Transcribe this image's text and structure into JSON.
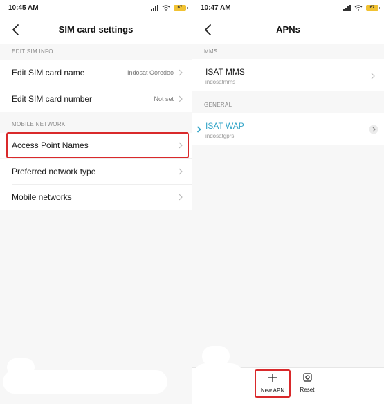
{
  "left": {
    "status": {
      "time": "10:45 AM",
      "battery": "67"
    },
    "title": "SIM card settings",
    "sections": [
      {
        "header": "EDIT SIM INFO"
      },
      {
        "header": "MOBILE NETWORK"
      }
    ],
    "rows": [
      {
        "label": "Edit SIM card name",
        "value": "Indosat Ooredoo"
      },
      {
        "label": "Edit SIM card number",
        "value": "Not set"
      },
      {
        "label": "Access Point Names",
        "value": ""
      },
      {
        "label": "Preferred network type",
        "value": ""
      },
      {
        "label": "Mobile networks",
        "value": ""
      }
    ]
  },
  "right": {
    "status": {
      "time": "10:47 AM",
      "battery": "67"
    },
    "title": "APNs",
    "sections": [
      {
        "header": "MMS"
      },
      {
        "header": "GENERAL"
      }
    ],
    "apns": [
      {
        "name": "ISAT MMS",
        "apn": "indosatmms"
      },
      {
        "name": "ISAT WAP",
        "apn": "indosatgprs"
      }
    ],
    "actions": [
      {
        "label": "New APN"
      },
      {
        "label": "Reset"
      }
    ]
  },
  "colors": {
    "accent": "#2fa3c7",
    "highlight": "#d9292b"
  },
  "icons": [
    "back-arrow-icon",
    "chevron-right-icon",
    "signal-icon",
    "wifi-icon",
    "battery-icon",
    "plus-icon",
    "reset-icon"
  ]
}
